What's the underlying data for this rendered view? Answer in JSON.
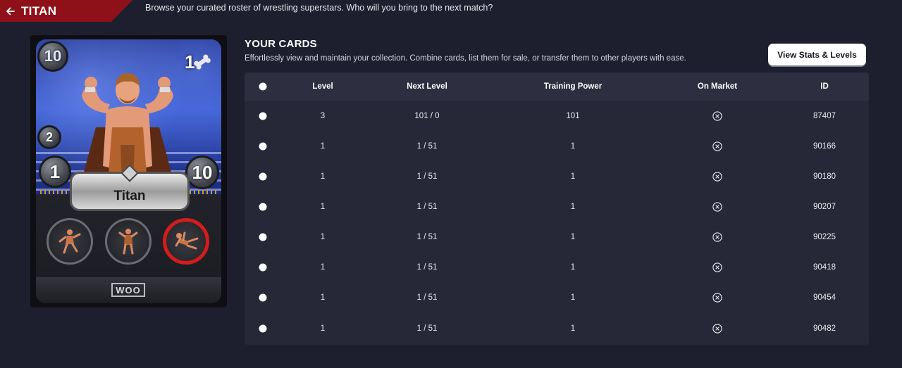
{
  "header": {
    "title": "TITAN",
    "subtitle": "Browse your curated roster of wrestling superstars. Who will you bring to the next match?"
  },
  "card": {
    "name": "Titan",
    "top_left_value": "10",
    "top_right_value": "1",
    "mid_left_value": "2",
    "lower_left_value": "1",
    "lower_right_value": "10",
    "footer_logo": "WOO"
  },
  "cards_section": {
    "title": "YOUR CARDS",
    "description": "Effortlessly view and maintain your collection. Combine cards, list them for sale, or transfer them to other players with ease.",
    "stats_button": "View Stats & Levels",
    "columns": [
      "Level",
      "Next Level",
      "Training Power",
      "On Market",
      "ID"
    ],
    "rows": [
      {
        "level": "3",
        "next_level": "101 / 0",
        "training_power": "101",
        "on_market": "no",
        "id": "87407"
      },
      {
        "level": "1",
        "next_level": "1 / 51",
        "training_power": "1",
        "on_market": "no",
        "id": "90166"
      },
      {
        "level": "1",
        "next_level": "1 / 51",
        "training_power": "1",
        "on_market": "no",
        "id": "90180"
      },
      {
        "level": "1",
        "next_level": "1 / 51",
        "training_power": "1",
        "on_market": "no",
        "id": "90207"
      },
      {
        "level": "1",
        "next_level": "1 / 51",
        "training_power": "1",
        "on_market": "no",
        "id": "90225"
      },
      {
        "level": "1",
        "next_level": "1 / 51",
        "training_power": "1",
        "on_market": "no",
        "id": "90418"
      },
      {
        "level": "1",
        "next_level": "1 / 51",
        "training_power": "1",
        "on_market": "no",
        "id": "90454"
      },
      {
        "level": "1",
        "next_level": "1 / 51",
        "training_power": "1",
        "on_market": "no",
        "id": "90482"
      }
    ]
  },
  "colors": {
    "background": "#1e1f2e",
    "accent_red": "#8e1119",
    "panel": "#272837"
  }
}
